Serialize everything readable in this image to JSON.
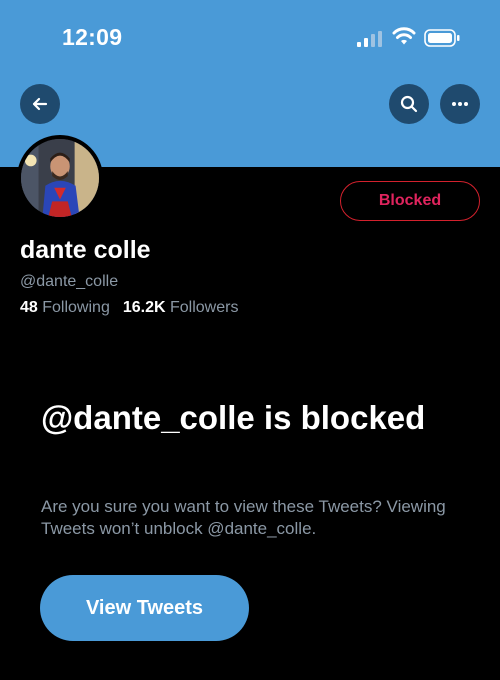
{
  "status_bar": {
    "time": "12:09",
    "icons": [
      "signal-icon",
      "wifi-icon",
      "battery-icon"
    ]
  },
  "header": {
    "banner_color": "#4a9ad7",
    "back_icon": "arrow-left-icon",
    "search_icon": "search-icon",
    "more_icon": "more-horizontal-icon"
  },
  "profile": {
    "display_name": "dante colle",
    "handle": "@dante_colle",
    "following_count": "48",
    "following_label": "Following",
    "followers_count": "16.2K",
    "followers_label": "Followers",
    "blocked_label": "Blocked",
    "blocked_color": "#e0245e"
  },
  "blocked_notice": {
    "title": "@dante_colle is blocked",
    "description": "Are you sure you want to view these Tweets? Viewing Tweets won’t unblock @dante_colle.",
    "view_button_label": "View Tweets"
  }
}
